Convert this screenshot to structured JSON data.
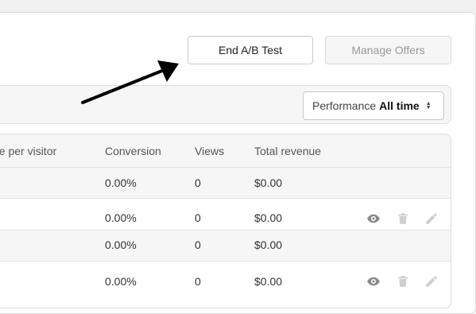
{
  "buttons": {
    "end_ab_test": "End A/B Test",
    "manage_offers": "Manage Offers"
  },
  "performance": {
    "label": "Performance",
    "value": "All time"
  },
  "table": {
    "columns": [
      "ue per visitor",
      "Conversion",
      "Views",
      "Total revenue"
    ],
    "rows": [
      {
        "conversion": "0.00%",
        "views": "0",
        "revenue": "$0.00",
        "actions": false
      },
      {
        "conversion": "0.00%",
        "views": "0",
        "revenue": "$0.00",
        "actions": true
      },
      {
        "conversion": "0.00%",
        "views": "0",
        "revenue": "$0.00",
        "actions": false
      },
      {
        "conversion": "0.00%",
        "views": "0",
        "revenue": "$0.00",
        "actions": true
      }
    ]
  },
  "icons": {
    "view": "eye-icon",
    "delete": "trash-icon",
    "edit": "pencil-icon"
  },
  "colors": {
    "icon_active": "#8a8a8a",
    "icon_disabled": "#cfcfcf"
  }
}
